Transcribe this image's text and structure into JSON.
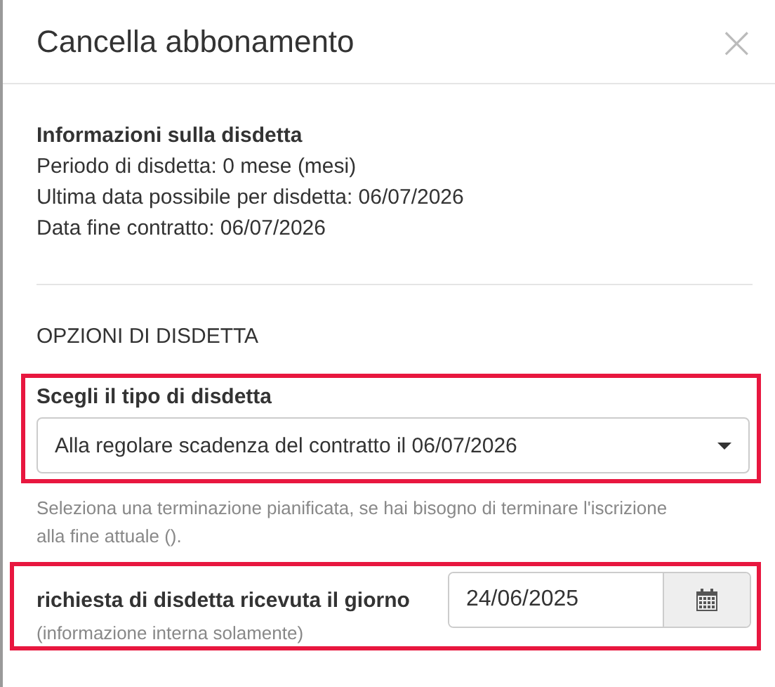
{
  "dialog": {
    "title": "Cancella abbonamento",
    "close": "×"
  },
  "info": {
    "heading": "Informazioni sulla disdetta",
    "lines": [
      "Periodo di disdetta: 0 mese (mesi)",
      "Ultima data possibile per disdetta: 06/07/2026",
      "Data fine contratto: 06/07/2026"
    ]
  },
  "options": {
    "heading": "OPZIONI DI DISDETTA",
    "type_field": {
      "label": "Scegli il tipo di disdetta",
      "value": "Alla regolare scadenza del contratto il 06/07/2026",
      "highlighted": true
    },
    "help": "Seleziona una terminazione pianificata, se hai bisogno di terminare l'iscrizione alla fine attuale ().",
    "date_field": {
      "label": "richiesta di disdetta ricevuta il giorno",
      "note": "(informazione interna solamente)",
      "value": "24/06/2025",
      "highlighted": true
    }
  }
}
